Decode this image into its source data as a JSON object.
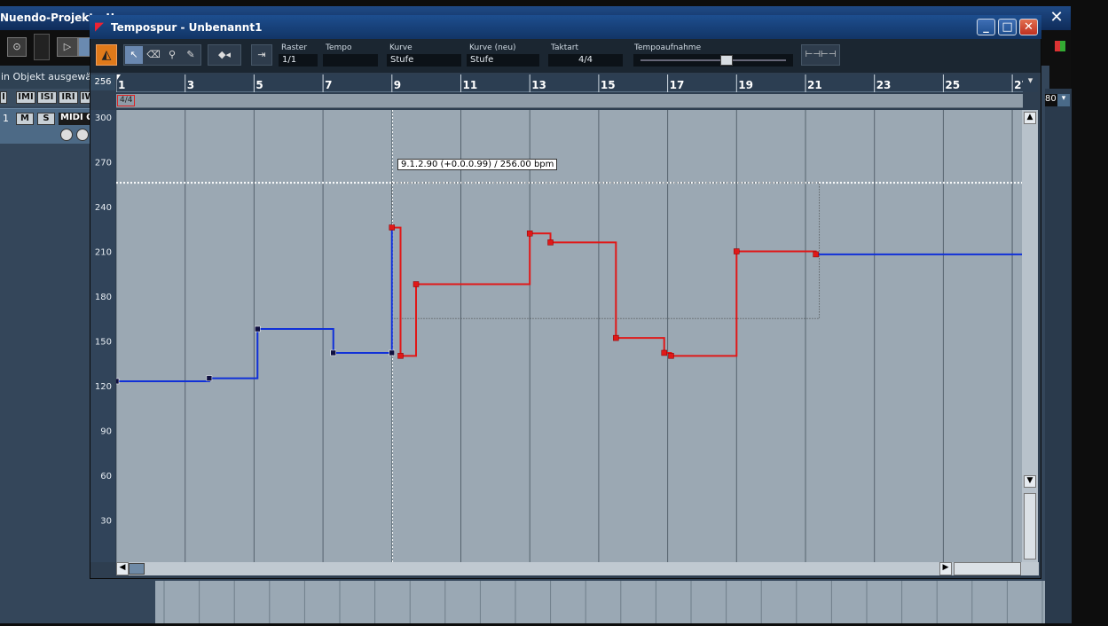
{
  "background": {
    "title": "Nuendo-Projekt - U",
    "close_icon": "✕",
    "status_text": "in Objekt ausgewähl",
    "track_number": "1",
    "mute_label": "M",
    "solo_label": "S",
    "midi_label": "MIDI C",
    "right_value": "80",
    "track_row_labels": [
      "I",
      "IMI",
      "ISI",
      "IRI",
      "IWI"
    ]
  },
  "window": {
    "title": "Tempospur - Unbenannt1",
    "minimize": "_",
    "maximize": "□",
    "close": "✕"
  },
  "toolbar": {
    "raster_label": "Raster",
    "raster_value": "1/1",
    "tempo_label": "Tempo",
    "tempo_value": "",
    "kurve_label": "Kurve",
    "kurve_value": "Stufe",
    "kurve_neu_label": "Kurve (neu)",
    "kurve_neu_value": "Stufe",
    "taktart_label": "Taktart",
    "taktart_value": "4/4",
    "tempoaufnahme_label": "Tempoaufnahme",
    "tempoaufnahme_level": 0.6
  },
  "ruler": {
    "corner_value": "256",
    "bars": [
      "1",
      "3",
      "5",
      "7",
      "9",
      "11",
      "13",
      "15",
      "17",
      "19",
      "21",
      "23",
      "25",
      "27"
    ]
  },
  "signature_lane": {
    "label": "4/4"
  },
  "y_axis": {
    "labels": [
      "300",
      "270",
      "240",
      "210",
      "180",
      "150",
      "120",
      "90",
      "60",
      "30"
    ]
  },
  "tooltip": "9.1.2.90 (+0.0.0.99) / 256.00 bpm",
  "tempo_curve": {
    "blue_points": [
      {
        "bar": 1,
        "bpm": 123
      },
      {
        "bar": 3.7,
        "bpm": 125
      },
      {
        "bar": 5.1,
        "bpm": 158
      },
      {
        "bar": 7.3,
        "bpm": 142
      },
      {
        "bar": 9.0,
        "bpm": 142
      }
    ],
    "red_points": [
      {
        "bar": 9.0,
        "bpm": 226
      },
      {
        "bar": 9.25,
        "bpm": 140
      },
      {
        "bar": 9.7,
        "bpm": 188
      },
      {
        "bar": 13.0,
        "bpm": 222
      },
      {
        "bar": 13.6,
        "bpm": 216
      },
      {
        "bar": 15.5,
        "bpm": 152
      },
      {
        "bar": 16.9,
        "bpm": 142
      },
      {
        "bar": 17.1,
        "bpm": 140
      },
      {
        "bar": 19.0,
        "bpm": 210
      },
      {
        "bar": 21.3,
        "bpm": 208
      }
    ],
    "tail_bpm": 208,
    "dashed_line_bpm": 256
  }
}
